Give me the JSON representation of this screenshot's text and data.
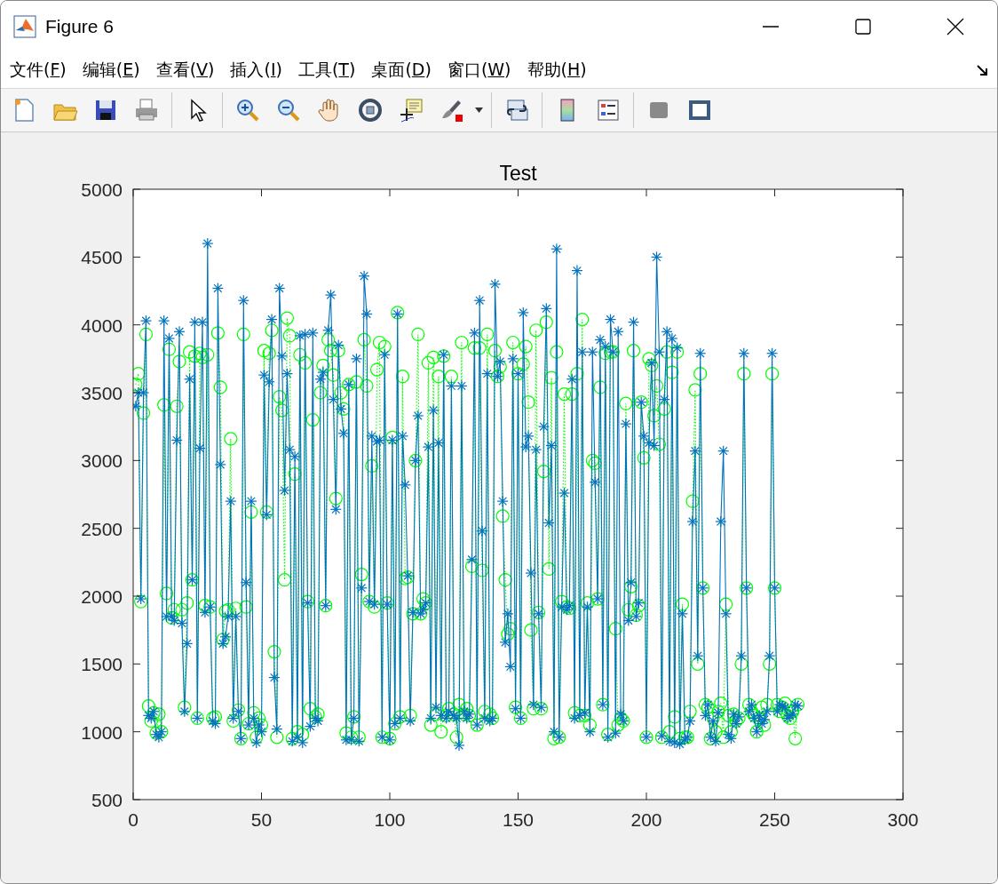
{
  "window": {
    "title": "Figure 6"
  },
  "menu": [
    {
      "label": "文件(F)"
    },
    {
      "label": "编辑(E)"
    },
    {
      "label": "查看(V)"
    },
    {
      "label": "插入(I)"
    },
    {
      "label": "工具(T)"
    },
    {
      "label": "桌面(D)"
    },
    {
      "label": "窗口(W)"
    },
    {
      "label": "帮助(H)"
    }
  ],
  "toolbar": [
    {
      "kind": "new"
    },
    {
      "kind": "open"
    },
    {
      "kind": "save"
    },
    {
      "kind": "print"
    },
    {
      "kind": "sep"
    },
    {
      "kind": "pointer"
    },
    {
      "kind": "sep"
    },
    {
      "kind": "zoom-in"
    },
    {
      "kind": "zoom-out"
    },
    {
      "kind": "pan"
    },
    {
      "kind": "rotate"
    },
    {
      "kind": "datatip"
    },
    {
      "kind": "brush"
    },
    {
      "kind": "sep"
    },
    {
      "kind": "link"
    },
    {
      "kind": "sep"
    },
    {
      "kind": "colorbar"
    },
    {
      "kind": "legend"
    },
    {
      "kind": "sep"
    },
    {
      "kind": "hide"
    },
    {
      "kind": "show"
    }
  ],
  "figure": {
    "chart_data": {
      "type": "line",
      "title": "Test",
      "xlim": [
        0,
        300
      ],
      "ylim": [
        500,
        5000
      ],
      "xticks": [
        0,
        50,
        100,
        150,
        200,
        250,
        300
      ],
      "yticks": [
        500,
        1000,
        1500,
        2000,
        2500,
        3000,
        3500,
        4000,
        4500,
        5000
      ],
      "x": [
        1,
        2,
        3,
        4,
        5,
        6,
        7,
        8,
        9,
        10,
        11,
        12,
        13,
        14,
        15,
        16,
        17,
        18,
        19,
        20,
        21,
        22,
        23,
        24,
        25,
        26,
        27,
        28,
        29,
        30,
        31,
        32,
        33,
        34,
        35,
        36,
        37,
        38,
        39,
        40,
        41,
        42,
        43,
        44,
        45,
        46,
        47,
        48,
        49,
        50,
        51,
        52,
        53,
        54,
        55,
        56,
        57,
        58,
        59,
        60,
        61,
        62,
        63,
        64,
        65,
        66,
        67,
        68,
        69,
        70,
        71,
        72,
        73,
        74,
        75,
        76,
        77,
        78,
        79,
        80,
        81,
        82,
        83,
        84,
        85,
        86,
        87,
        88,
        89,
        90,
        91,
        92,
        93,
        94,
        95,
        96,
        97,
        98,
        99,
        100,
        101,
        102,
        103,
        104,
        105,
        106,
        107,
        108,
        109,
        110,
        111,
        112,
        113,
        114,
        115,
        116,
        117,
        118,
        119,
        120,
        121,
        122,
        123,
        124,
        125,
        126,
        127,
        128,
        129,
        130,
        131,
        132,
        133,
        134,
        135,
        136,
        137,
        138,
        139,
        140,
        141,
        142,
        143,
        144,
        145,
        146,
        147,
        148,
        149,
        150,
        151,
        152,
        153,
        154,
        155,
        156,
        157,
        158,
        159,
        160,
        161,
        162,
        163,
        164,
        165,
        166,
        167,
        168,
        169,
        170,
        171,
        172,
        173,
        174,
        175,
        176,
        177,
        178,
        179,
        180,
        181,
        182,
        183,
        184,
        185,
        186,
        187,
        188,
        189,
        190,
        191,
        192,
        193,
        194,
        195,
        196,
        197,
        198,
        199,
        200,
        201,
        202,
        203,
        204,
        205,
        206,
        207,
        208,
        209,
        210,
        211,
        212,
        213,
        214,
        215,
        216,
        217,
        218,
        219,
        220,
        221,
        222,
        223,
        224,
        225,
        226,
        227,
        228,
        229,
        230,
        231,
        232,
        233,
        234,
        235,
        236,
        237,
        238,
        239,
        240,
        241,
        242,
        243,
        244,
        245,
        246,
        247,
        248,
        249,
        250,
        251,
        252,
        253,
        254,
        255,
        256,
        257,
        258,
        259
      ],
      "series": [
        {
          "color": "#0072bd",
          "marker": "cross",
          "line_style": "solid",
          "values": [
            3400,
            3500,
            1980,
            3500,
            4030,
            1120,
            1100,
            1150,
            980,
            960,
            1000,
            4030,
            1850,
            3900,
            1850,
            1820,
            3150,
            3950,
            1800,
            1150,
            1650,
            3600,
            2120,
            4020,
            1100,
            3090,
            4020,
            1880,
            4600,
            1920,
            1080,
            1060,
            4270,
            2970,
            1650,
            1700,
            1850,
            2700,
            1100,
            1850,
            1150,
            950,
            4180,
            2100,
            1050,
            2700,
            1100,
            920,
            1050,
            1000,
            3630,
            2600,
            3580,
            4040,
            1400,
            1020,
            4270,
            3770,
            2780,
            3640,
            3080,
            930,
            3030,
            960,
            3920,
            920,
            3930,
            1950,
            1040,
            3940,
            1100,
            1080,
            3600,
            3650,
            1930,
            3960,
            4220,
            3450,
            2640,
            3850,
            3380,
            3200,
            940,
            3560,
            940,
            1100,
            3750,
            930,
            2060,
            4360,
            4080,
            1960,
            3180,
            1940,
            3140,
            3150,
            960,
            3780,
            1940,
            940,
            3150,
            1060,
            4080,
            1100,
            3180,
            2820,
            2150,
            1080,
            1880,
            3000,
            3330,
            1870,
            1900,
            1950,
            3100,
            1100,
            3370,
            1180,
            3130,
            1120,
            3780,
            1100,
            1150,
            3550,
            1120,
            1100,
            900,
            3550,
            1150,
            1100,
            1130,
            2270,
            3940,
            1050,
            4180,
            2480,
            1100,
            3640,
            1080,
            1100,
            4300,
            3620,
            3730,
            2700,
            1660,
            1870,
            1480,
            3750,
            1170,
            3640,
            1100,
            4090,
            3100,
            3180,
            2170,
            1200,
            3080,
            1870,
            1180,
            3250,
            4120,
            2540,
            3110,
            1000,
            4560,
            960,
            1920,
            2760,
            1900,
            1930,
            3600,
            1100,
            4400,
            1120,
            3800,
            1140,
            1920,
            1000,
            3800,
            2840,
            1980,
            3890,
            1200,
            3840,
            960,
            4040,
            3800,
            990,
            3950,
            1130,
            1080,
            3270,
            1820,
            2100,
            4020,
            1850,
            1950,
            3430,
            3180,
            960,
            3130,
            3720,
            3110,
            4500,
            3800,
            970,
            3450,
            3950,
            930,
            3900,
            920,
            3830,
            910,
            1870,
            940,
            960,
            1080,
            2550,
            3070,
            1560,
            3790,
            2060,
            1120,
            1200,
            960,
            1080,
            930,
            1140,
            2550,
            3070,
            1870,
            980,
            950,
            1130,
            1060,
            1110,
            1560,
            3790,
            2060,
            1150,
            1200,
            1100,
            1000,
            1120,
            1060,
            1090,
            1150,
            1560,
            3790,
            2060,
            1150,
            1200,
            1190,
            1180,
            1100,
            1120,
            1130,
            1200,
            1190
          ]
        },
        {
          "color": "#00ff00",
          "marker": "circle",
          "line_style": "dotted",
          "values": [
            3560,
            3640,
            1960,
            3350,
            3930,
            1190,
            1080,
            1140,
            990,
            1130,
            1000,
            3410,
            2020,
            3820,
            1840,
            1900,
            3400,
            3730,
            1900,
            1180,
            1950,
            3800,
            2120,
            3770,
            1100,
            3790,
            3760,
            1930,
            3780,
            1920,
            1100,
            1110,
            3940,
            3540,
            1680,
            1890,
            1900,
            3160,
            1080,
            1910,
            1160,
            950,
            3930,
            1920,
            1060,
            2620,
            1140,
            960,
            1100,
            1050,
            3810,
            2620,
            3790,
            3960,
            1590,
            960,
            3470,
            3370,
            2120,
            4050,
            3920,
            950,
            2900,
            1000,
            3780,
            980,
            3720,
            1960,
            1170,
            3300,
            1110,
            1130,
            3500,
            3700,
            1930,
            3890,
            3810,
            3630,
            2720,
            3810,
            3500,
            3380,
            990,
            3560,
            960,
            1110,
            3580,
            960,
            2160,
            3890,
            3550,
            1960,
            2960,
            1920,
            3670,
            3870,
            960,
            3840,
            1950,
            950,
            3170,
            1060,
            4090,
            1110,
            3620,
            2130,
            2140,
            1120,
            1870,
            3000,
            3930,
            1870,
            1980,
            1950,
            3720,
            1050,
            3760,
            1130,
            3620,
            1000,
            3770,
            1120,
            1170,
            3620,
            1130,
            960,
            1200,
            3870,
            1130,
            1170,
            1120,
            2220,
            3830,
            1050,
            3830,
            2190,
            1150,
            3930,
            1130,
            1100,
            3810,
            3620,
            3690,
            2590,
            2120,
            1720,
            1760,
            3870,
            1180,
            3640,
            1100,
            3710,
            3840,
            3430,
            1750,
            1170,
            3960,
            1880,
            1170,
            2920,
            4020,
            2200,
            3610,
            950,
            3800,
            960,
            1960,
            3490,
            1920,
            1910,
            3490,
            1140,
            3640,
            1120,
            4040,
            1120,
            1950,
            1050,
            3000,
            2980,
            1980,
            3540,
            1200,
            3790,
            980,
            3800,
            3800,
            1760,
            1050,
            1100,
            1080,
            3420,
            1900,
            2070,
            3810,
            1860,
            1930,
            3430,
            3020,
            960,
            3750,
            3700,
            3330,
            3550,
            3120,
            960,
            3380,
            3800,
            1000,
            3650,
            1110,
            3800,
            950,
            1940,
            960,
            960,
            1150,
            2700,
            3520,
            1500,
            3640,
            2060,
            1200,
            1180,
            950,
            1100,
            1000,
            1150,
            1210,
            960,
            1940,
            1120,
            1000,
            1130,
            1080,
            1100,
            1500,
            3640,
            2060,
            1200,
            1150,
            1120,
            1000,
            1100,
            1180,
            1050,
            1200,
            1500,
            3640,
            2060,
            1200,
            1150,
            1180,
            1210,
            1120,
            1100,
            1150,
            950,
            1200
          ]
        }
      ]
    }
  }
}
